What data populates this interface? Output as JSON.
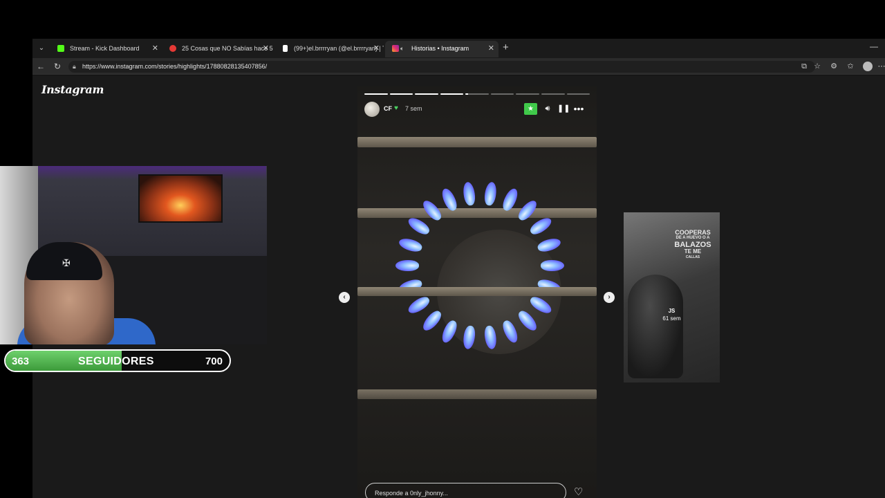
{
  "browser": {
    "tabs": [
      {
        "title": "Stream - Kick Dashboard",
        "favicon_color": "#53fc18",
        "active": false
      },
      {
        "title": "25 Cosas que NO Sabías hace 5 m",
        "favicon_color": "#e53935",
        "active": false
      },
      {
        "title": "(99+)el.brrrryan (@el.brrrryan) | Ti",
        "favicon_color": "#ffffff",
        "active": false
      },
      {
        "title": "Historias • Instagram",
        "favicon_color": "#e1306c",
        "active": true
      }
    ],
    "url": "https://www.instagram.com/stories/highlights/17880828135407856/"
  },
  "instagram": {
    "logo": "Instagram",
    "story": {
      "username": "CF",
      "time_ago": "7 sem",
      "segments_total": 9,
      "segments_done": 4,
      "current_segment_progress": 0.12,
      "reply_placeholder": "Responde a 0nly_jhonny...",
      "icons": [
        "star-icon",
        "volume-icon",
        "pause-icon",
        "more-icon",
        "heart-icon"
      ]
    },
    "next_story": {
      "caption_lines": [
        "COOPERAS",
        "DE A HUEVO O A",
        "BALAZOS",
        "TE ME",
        "CALLAS"
      ],
      "username": "JS",
      "time_ago": "61 sem"
    }
  },
  "overlay": {
    "followers_current": "363",
    "followers_label": "SEGUIDORES",
    "followers_goal": "700",
    "progress_fraction": 0.52,
    "accent_color": "#4fb84c"
  }
}
